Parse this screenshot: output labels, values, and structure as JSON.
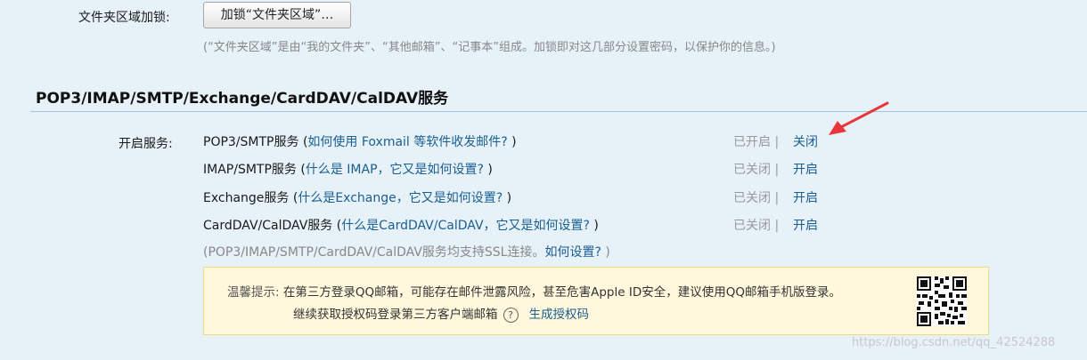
{
  "lock": {
    "label": "文件夹区域加锁:",
    "button": "加锁“文件夹区域”…",
    "note": "(“文件夹区域”是由“我的文件夹”、“其他邮箱”、“记事本”组成。加锁即对这几部分设置密码，以保护你的信息。)"
  },
  "section": {
    "title": "POP3/IMAP/SMTP/Exchange/CardDAV/CalDAV服务"
  },
  "services": {
    "label": "开启服务:",
    "items": [
      {
        "name": "POP3/SMTP服务 (",
        "help": "如何使用 Foxmail 等软件收发邮件?",
        "close": " )",
        "status": "已开启 |",
        "action": "关闭"
      },
      {
        "name": "IMAP/SMTP服务 (",
        "help": "什么是 IMAP，它又是如何设置?",
        "close": " )",
        "status": "已关闭 |",
        "action": "开启"
      },
      {
        "name": "Exchange服务 (",
        "help": "什么是Exchange，它又是如何设置?",
        "close": " )",
        "status": "已关闭 |",
        "action": "开启"
      },
      {
        "name": "CardDAV/CalDAV服务 (",
        "help": "什么是CardDAV/CalDAV，它又是如何设置?",
        "close": " )",
        "status": "已关闭 |",
        "action": "开启"
      }
    ],
    "ssl_note_prefix": "(POP3/IMAP/SMTP/CardDAV/CalDAV服务均支持SSL连接。",
    "ssl_note_link": "如何设置?",
    "ssl_note_suffix": " )"
  },
  "tip": {
    "label": "温馨提示:",
    "line1": "在第三方登录QQ邮箱，可能存在邮件泄露风险，甚至危害Apple ID安全，建议使用QQ邮箱手机版登录。",
    "line2": "继续获取授权码登录第三方客户端邮箱",
    "qmark": "?",
    "link": "生成授权码"
  },
  "watermark": "https://blog.csdn.net/qq_42524288",
  "colors": {
    "background": "#e6f1f8",
    "link": "#1a5e92",
    "arrow": "#e8363c",
    "tip_bg": "#fff8dc"
  }
}
